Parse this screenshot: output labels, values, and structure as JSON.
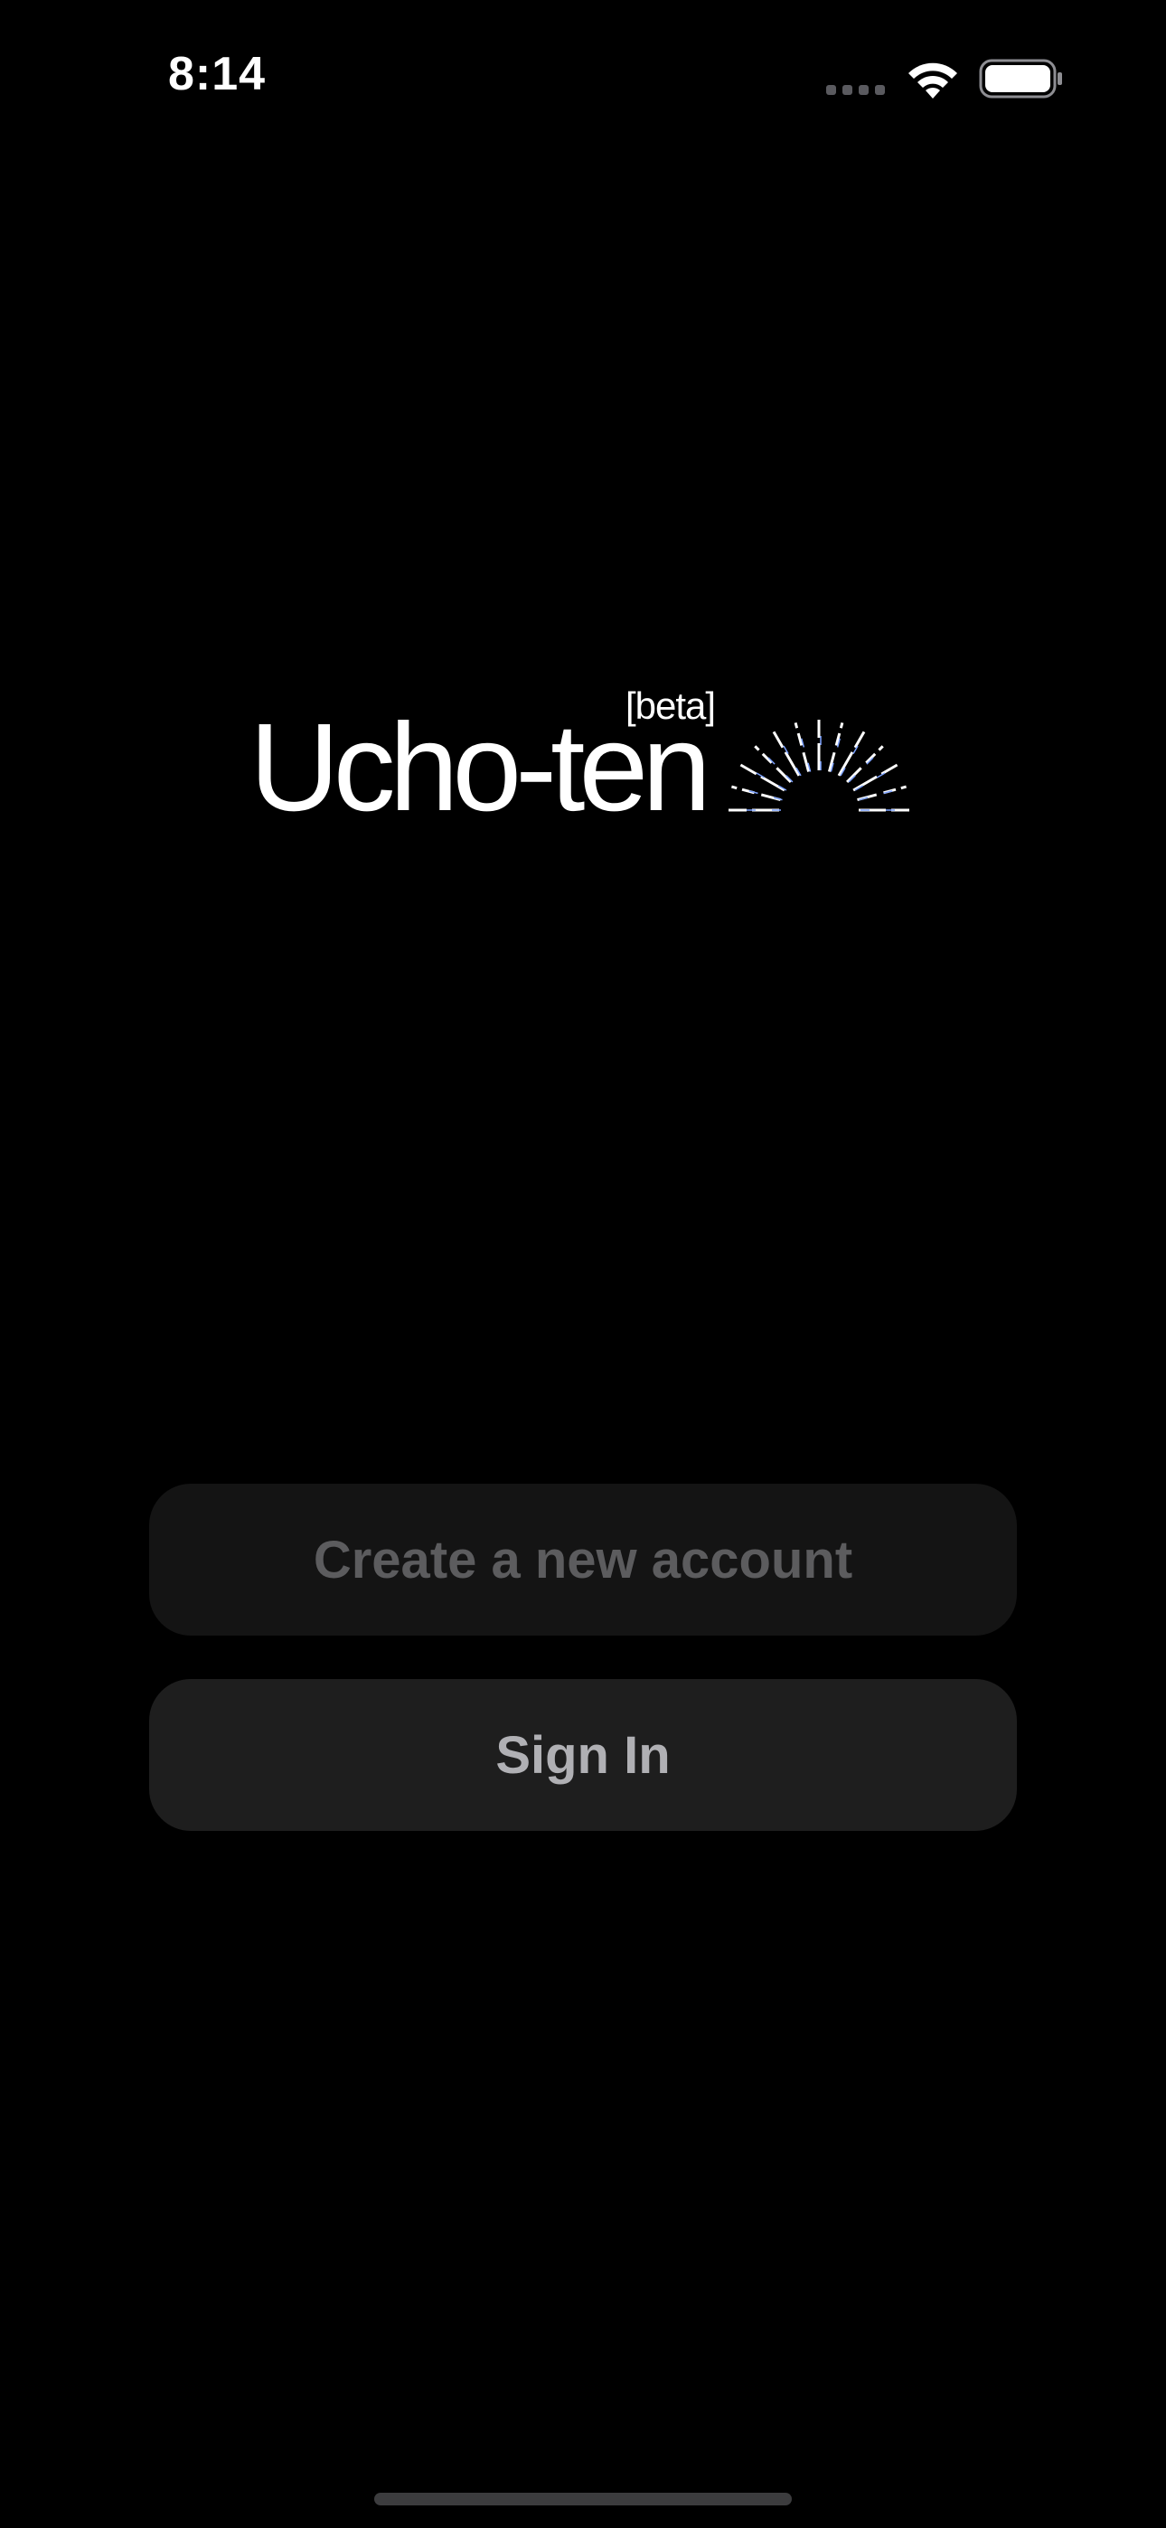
{
  "status_bar": {
    "time": "8:14",
    "icons": [
      "cellular-signal-icon",
      "wifi-icon",
      "battery-icon"
    ]
  },
  "logo": {
    "wordmark": "Ucho-ten",
    "badge": "[beta]",
    "rays_icon": "sunrise-rays-icon"
  },
  "actions": {
    "create_account_label": "Create a new account",
    "sign_in_label": "Sign In"
  },
  "colors": {
    "background": "#000000",
    "create_button_bg": "#141414",
    "create_button_text": "#5c5c5e",
    "sign_in_button_bg": "#1e1e1e",
    "sign_in_button_text": "#b0b0b4",
    "ray_accent": "#7da2ff"
  }
}
